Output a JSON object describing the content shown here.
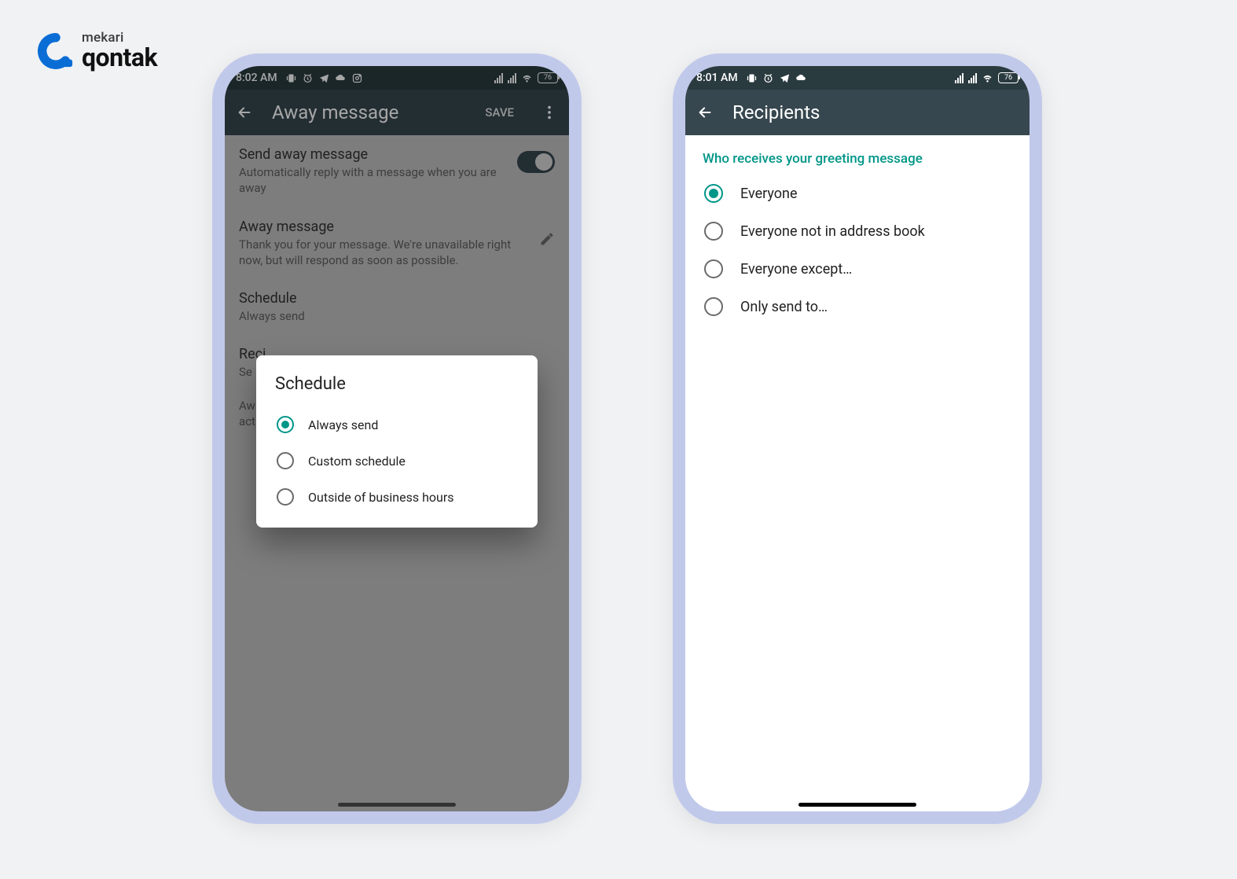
{
  "logo": {
    "top": "mekari",
    "bottom": "qontak"
  },
  "phone1": {
    "status": {
      "time": "8:02 AM",
      "battery": "76"
    },
    "appbar": {
      "title": "Away message",
      "save": "SAVE"
    },
    "rows": {
      "toggle": {
        "title": "Send away message",
        "sub": "Automatically reply with a message when you are away"
      },
      "message": {
        "title": "Away message",
        "sub": "Thank you for your message. We're unavailable right now, but will respond as soon as possible."
      },
      "schedule": {
        "title": "Schedule",
        "sub": "Always send"
      },
      "recipients": {
        "title": "Reci",
        "sub": "Se"
      },
      "footnote": {
        "line1": "Aw",
        "line2": "act"
      }
    },
    "dialog": {
      "title": "Schedule",
      "options": [
        {
          "label": "Always send",
          "checked": true
        },
        {
          "label": "Custom schedule",
          "checked": false
        },
        {
          "label": "Outside of business hours",
          "checked": false
        }
      ]
    }
  },
  "phone2": {
    "status": {
      "time": "8:01 AM",
      "battery": "76"
    },
    "appbar": {
      "title": "Recipients"
    },
    "section": "Who receives your greeting message",
    "options": [
      {
        "label": "Everyone",
        "checked": true
      },
      {
        "label": "Everyone not in address book",
        "checked": false
      },
      {
        "label": "Everyone except…",
        "checked": false
      },
      {
        "label": "Only send to…",
        "checked": false
      }
    ]
  }
}
